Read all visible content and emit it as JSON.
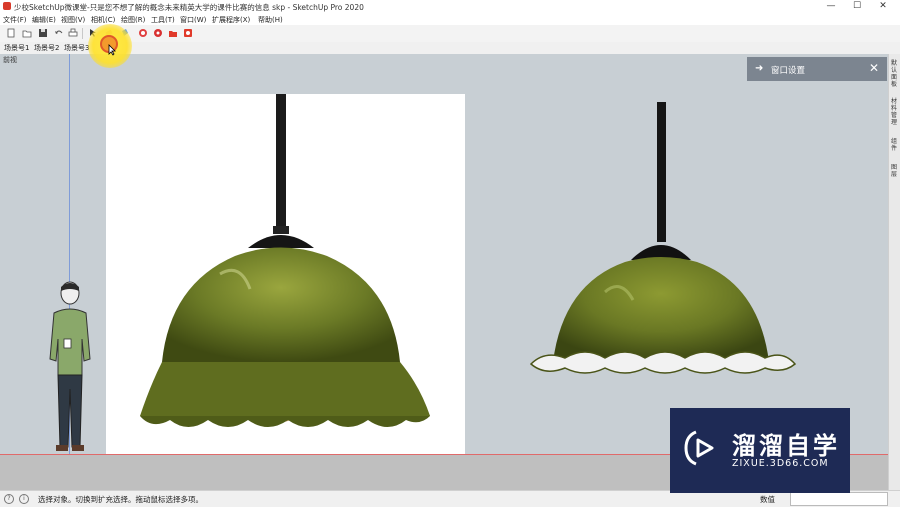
{
  "window": {
    "title": "少校SketchUp微课堂-只是您不想了解的概念未来精英大学的课件比赛的信息 skp - SketchUp Pro 2020",
    "controls": [
      "—",
      "☐",
      "✕"
    ]
  },
  "menubar": {
    "items": [
      "文件(F)",
      "编辑(E)",
      "视图(V)",
      "相机(C)",
      "绘图(R)",
      "工具(T)",
      "窗口(W)",
      "扩展程序(X)",
      "帮助(H)"
    ]
  },
  "toolbar": {
    "icons": [
      "new-icon",
      "open-icon",
      "save-icon",
      "undo-icon",
      "print-icon",
      "select-icon",
      "eraser-icon",
      "paint-icon",
      "camera-icon",
      "gear-icon",
      "folder-icon",
      "screenshot-icon"
    ]
  },
  "scenes": {
    "tabs": [
      "场景号1",
      "场景号2",
      "场景号3"
    ]
  },
  "viewport": {
    "label": "前视"
  },
  "window_panel": {
    "title": "窗口设置",
    "arrow": "➜",
    "close": "✕"
  },
  "right_tray": {
    "tabs": [
      "默认面板",
      "材料管理",
      "组件",
      "图层"
    ]
  },
  "statusbar": {
    "hint": "选择对象。切换到扩充选择。拖动鼠标选择多项。",
    "measure_label": "数值",
    "measure_value": ""
  },
  "watermark": {
    "title": "溜溜自学",
    "url": "ZIXUE.3D66.COM"
  },
  "colors": {
    "viewport_bg": "#c8cfd4",
    "ground": "#bfbfbf",
    "lamp_glass": "#6b7a26",
    "highlight": "#ffe23c",
    "watermark_bg": "#1e2a55"
  }
}
